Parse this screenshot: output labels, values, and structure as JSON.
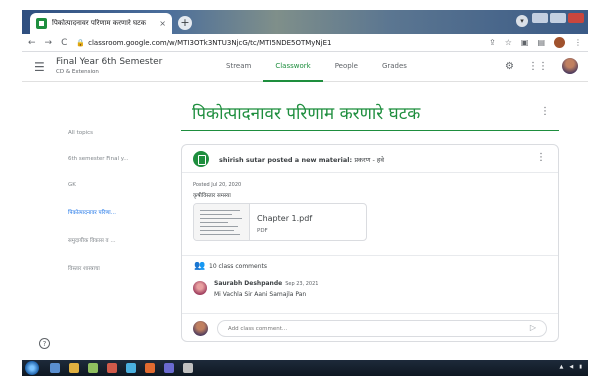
{
  "browser": {
    "tab_title": "पिकोत्पादनावर परिणाम करणारे घटक",
    "tab_close": "×",
    "new_tab": "+",
    "url": "classroom.google.com/w/MTI3OTk3NTU3NjcG/tc/MTI5NDE5OTMyNjE1",
    "back": "←",
    "forward": "→",
    "reload": "C"
  },
  "header": {
    "course_title": "Final Year 6th Semester",
    "course_subtitle": "CD & Extension",
    "tabs": [
      {
        "label": "Stream"
      },
      {
        "label": "Classwork"
      },
      {
        "label": "People"
      },
      {
        "label": "Grades"
      }
    ]
  },
  "sidebar": {
    "items": [
      {
        "label": "All topics"
      },
      {
        "label": "6th semester Final y..."
      },
      {
        "label": "GK"
      },
      {
        "label": "पिकोत्पादनावर परिणा..."
      },
      {
        "label": "समुदायीक विकास व ..."
      },
      {
        "label": "विस्तार शास्त्राचा"
      }
    ]
  },
  "topic": {
    "title": "पिकोत्पादनावर परिणाम करणारे घटक"
  },
  "post": {
    "author": "shirish sutar",
    "action": " posted a new material: ",
    "material_title": "प्रकरण - हवे",
    "posted_date": "Posted Jul 20, 2020",
    "description": "कृषीविस्तार समस्या",
    "attachment": {
      "name": "Chapter 1.pdf",
      "type": "PDF"
    },
    "comments_count": "10 class comments",
    "comment": {
      "author": "Saurabh Deshpande",
      "date": "Sep 23, 2021",
      "text": "Mi Vachla Sir Aani Samajla Pan"
    },
    "add_comment_placeholder": "Add class comment..."
  },
  "help": {
    "label": "?"
  }
}
